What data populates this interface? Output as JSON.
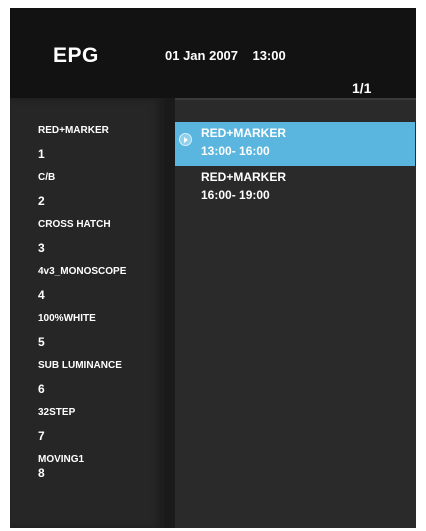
{
  "header": {
    "title": "EPG",
    "date": "01 Jan 2007",
    "time": "13:00",
    "page": "1/1"
  },
  "channels": [
    {
      "name": "RED+MARKER",
      "number": "1"
    },
    {
      "name": "C/B",
      "number": "2"
    },
    {
      "name": "CROSS HATCH",
      "number": "3"
    },
    {
      "name": "4v3_MONOSCOPE",
      "number": "4"
    },
    {
      "name": "100%WHITE",
      "number": "5"
    },
    {
      "name": "SUB LUMINANCE",
      "number": "6"
    },
    {
      "name": "32STEP",
      "number": "7"
    },
    {
      "name": "MOVING1",
      "number": "8"
    }
  ],
  "programs": [
    {
      "title": "RED+MARKER",
      "time": "13:00- 16:00",
      "selected": true
    },
    {
      "title": "RED+MARKER",
      "time": "16:00- 19:00",
      "selected": false
    }
  ],
  "icons": {
    "selected_program": "play-circle-icon"
  },
  "colors": {
    "selection": "#5ab6df",
    "background": "#1e1e1e"
  }
}
